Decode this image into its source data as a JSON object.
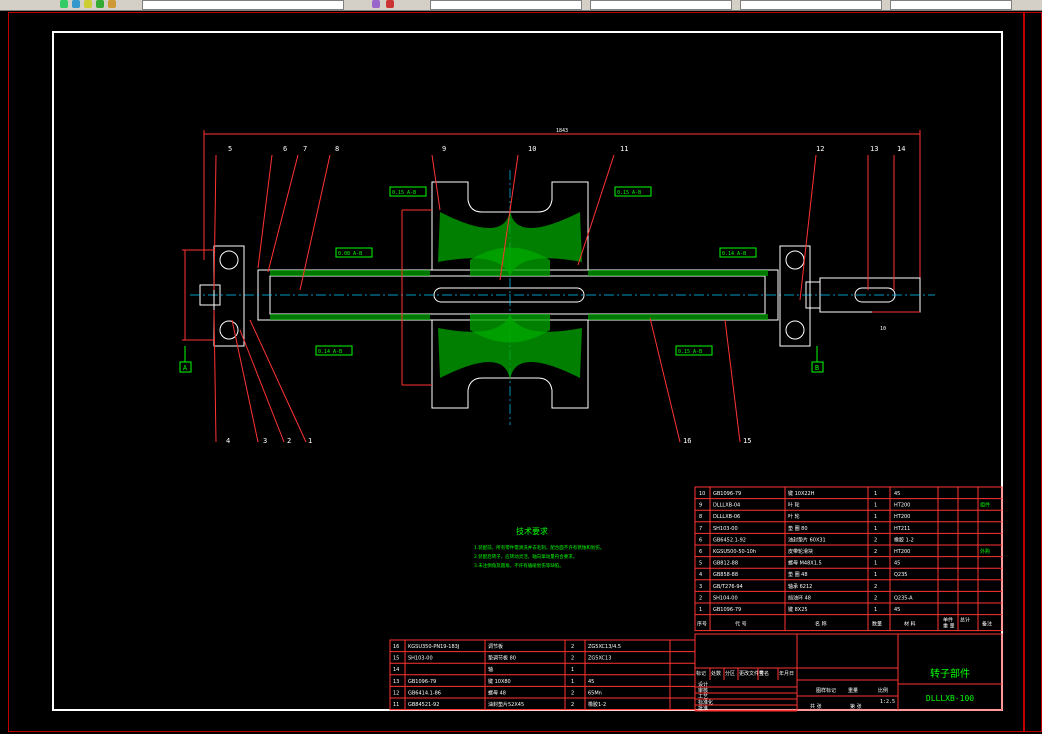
{
  "toolbar": {
    "command_value": "",
    "status_value": ""
  },
  "drawing": {
    "overall_dim": "1843",
    "dim_right": "10",
    "datum_a": "A",
    "datum_b": "B",
    "gdt_1": "0.15 A-B",
    "gdt_2": "0.15 A-B",
    "gdt_3": "0.08 A-B",
    "gdt_4": "0.14 A-B",
    "gdt_5": "0.14 A-B",
    "gdt_6": "0.15 A-B",
    "balloons_top": [
      "5",
      "6",
      "7",
      "8",
      "9",
      "10",
      "11",
      "12",
      "13",
      "14"
    ],
    "balloons_bottom": [
      "4",
      "3",
      "2",
      "1",
      "16",
      "15"
    ]
  },
  "notes": {
    "title": "技术要求",
    "lines": [
      "1.装配前，所有零件需清洗并去毛刺，配合面不许有锈蚀和划伤。",
      "2.装配后转子，应转动灵活，轴向窜动量符合要求。",
      "3.未注倒角及圆角，不许有磕碰划伤等缺陷。"
    ]
  },
  "bom_main": [
    {
      "no": "10",
      "code": "GB1096-79",
      "name": "键 10X22H",
      "qty": "1",
      "mat": "45",
      "note": ""
    },
    {
      "no": "9",
      "code": "DLLLXB-04",
      "name": "叶 轮",
      "qty": "1",
      "mat": "HT200",
      "note": "组件"
    },
    {
      "no": "8",
      "code": "DLLLXB-06",
      "name": "叶 轮",
      "qty": "1",
      "mat": "HT200",
      "note": ""
    },
    {
      "no": "7",
      "code": "SH103-00",
      "name": "垫 圈 80",
      "qty": "1",
      "mat": "HT211",
      "note": ""
    },
    {
      "no": "6",
      "code": "GB6452.1-92",
      "name": "油封垫片 60X31",
      "qty": "2",
      "mat": "橡胶 1-2",
      "note": ""
    },
    {
      "no": "6",
      "code": "KGSU500-50-10h",
      "name": "皮带轮滑块",
      "qty": "2",
      "mat": "HT200",
      "note": "外购"
    },
    {
      "no": "5",
      "code": "GB812-88",
      "name": "螺母 M48X1.5",
      "qty": "1",
      "mat": "45",
      "note": ""
    },
    {
      "no": "4",
      "code": "GB858-88",
      "name": "垫 圈 48",
      "qty": "1",
      "mat": "Q235",
      "note": ""
    },
    {
      "no": "3",
      "code": "GB/T276-94",
      "name": "轴承 6212",
      "qty": "2",
      "mat": "",
      "note": ""
    },
    {
      "no": "2",
      "code": "SH104-00",
      "name": "挡油环 48",
      "qty": "2",
      "mat": "Q235-A",
      "note": ""
    },
    {
      "no": "1",
      "code": "GB1096-79",
      "name": "键 8X25",
      "qty": "1",
      "mat": "45",
      "note": ""
    }
  ],
  "bom_header": {
    "no": "序号",
    "code": "代 号",
    "name": "名 称",
    "qty": "数量",
    "mat": "材 料",
    "w1": "单件",
    "w2": "总计",
    "note": "备注",
    "wt": "重 量"
  },
  "bom_extra": [
    {
      "no": "16",
      "code": "KGSU350-PN19-183J",
      "name": "调节板",
      "qty": "2",
      "mat": "ZG5XC13/4.5",
      "note": ""
    },
    {
      "no": "15",
      "code": "SH103-00",
      "name": "垫调节板 80",
      "qty": "2",
      "mat": "ZG5XC13",
      "note": ""
    },
    {
      "no": "14",
      "code": "",
      "name": "轴",
      "qty": "1",
      "mat": "",
      "note": ""
    },
    {
      "no": "13",
      "code": "GB1096-79",
      "name": "键 10X80",
      "qty": "1",
      "mat": "45",
      "note": ""
    },
    {
      "no": "12",
      "code": "GB6414.1-86",
      "name": "螺母 48",
      "qty": "2",
      "mat": "65Mn",
      "note": ""
    },
    {
      "no": "11",
      "code": "GB84521-92",
      "name": "油封垫片52X45",
      "qty": "2",
      "mat": "橡胶1-2",
      "note": ""
    }
  ],
  "titleblock": {
    "drawing_title": "转子部件",
    "drawing_code": "DLLLXB-100",
    "stage": "图样标记",
    "weight": "重量",
    "scale": "比例",
    "scale_value": "1:2.5",
    "rows": [
      "标记",
      "处数",
      "分区",
      "更改文件号",
      "签名",
      "年月日"
    ],
    "roles": [
      "设计",
      "审核",
      "工艺",
      "标准化",
      "批准"
    ],
    "sheet": "共 张",
    "sheet2": "第 张"
  }
}
